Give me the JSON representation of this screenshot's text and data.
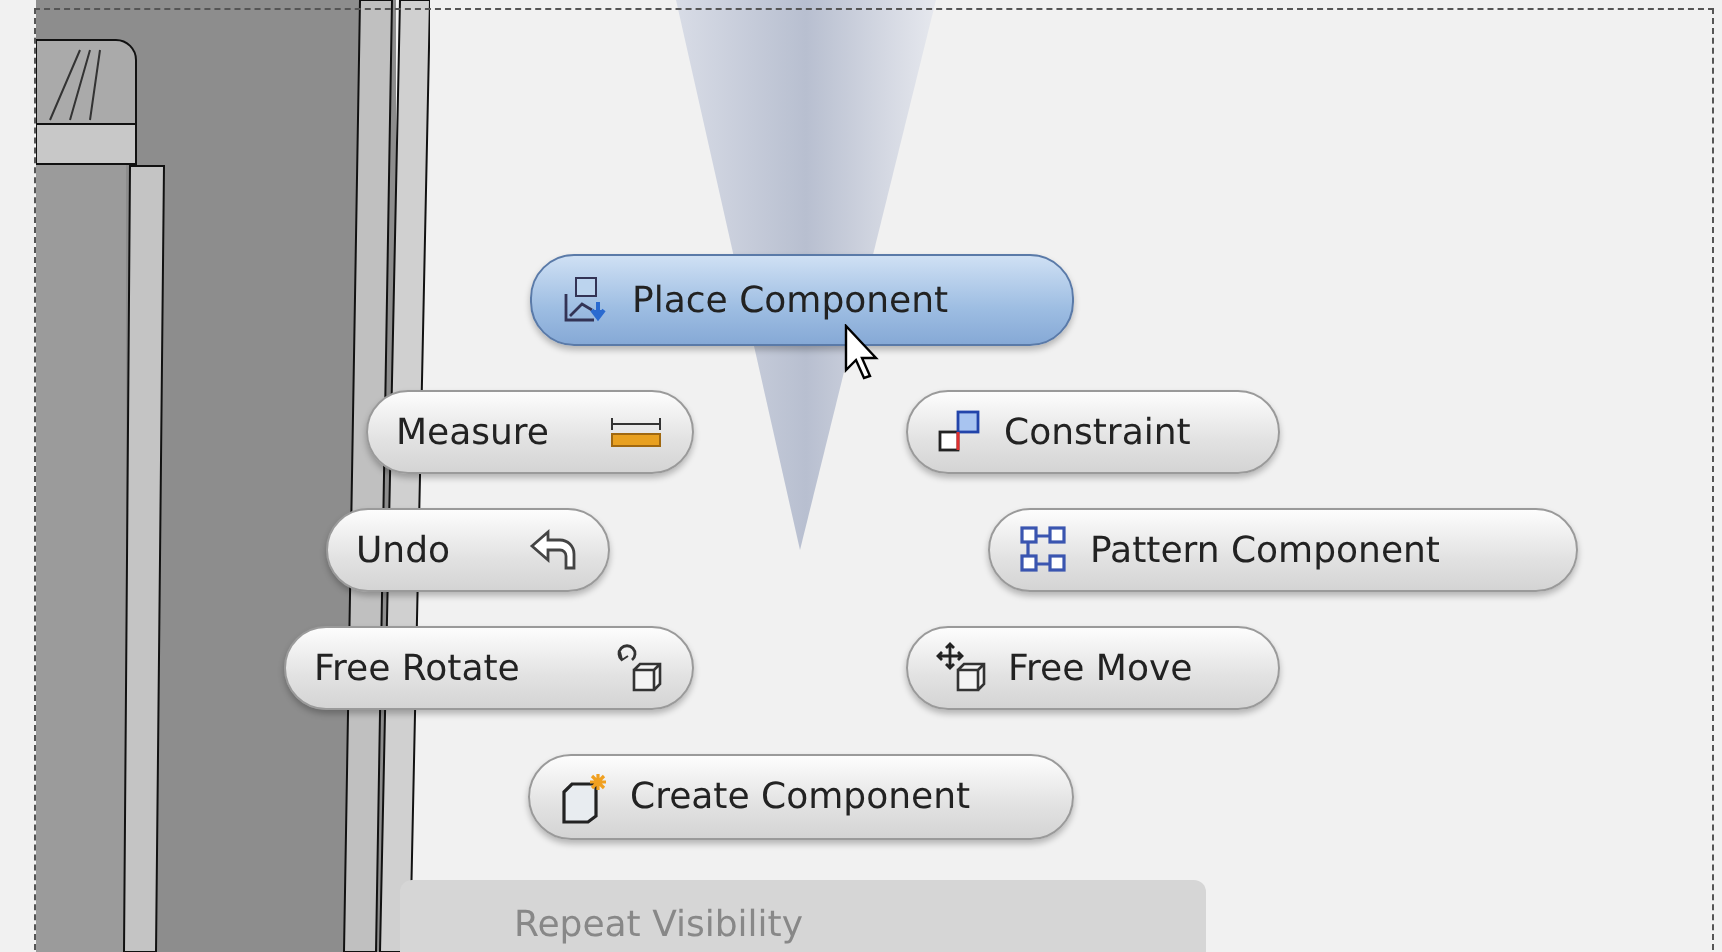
{
  "marking_menu": {
    "items": [
      {
        "label": "Place Component",
        "selected": true
      },
      {
        "label": "Measure",
        "selected": false
      },
      {
        "label": "Constraint",
        "selected": false
      },
      {
        "label": "Undo",
        "selected": false
      },
      {
        "label": "Pattern Component",
        "selected": false
      },
      {
        "label": "Free Rotate",
        "selected": false
      },
      {
        "label": "Free Move",
        "selected": false
      },
      {
        "label": "Create Component",
        "selected": false
      }
    ]
  },
  "overflow_menu": {
    "items": [
      {
        "label": "Repeat Visibility",
        "disabled": true
      }
    ]
  }
}
